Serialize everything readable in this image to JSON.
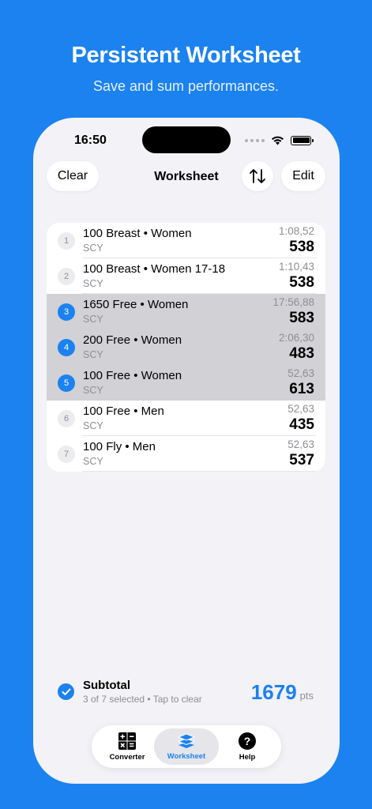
{
  "promo": {
    "headline": "Persistent Worksheet",
    "subhead": "Save and sum performances."
  },
  "status_bar": {
    "time": "16:50"
  },
  "nav": {
    "clear_label": "Clear",
    "title": "Worksheet",
    "edit_label": "Edit",
    "sort_icon": "sort-arrows-icon"
  },
  "rows": [
    {
      "num": "1",
      "event": "100 Breast • Women",
      "course": "SCY",
      "time": "1:08,52",
      "points": "538",
      "selected": false
    },
    {
      "num": "2",
      "event": "100 Breast • Women 17-18",
      "course": "SCY",
      "time": "1:10,43",
      "points": "538",
      "selected": false
    },
    {
      "num": "3",
      "event": "1650 Free • Women",
      "course": "SCY",
      "time": "17:56,88",
      "points": "583",
      "selected": true
    },
    {
      "num": "4",
      "event": "200 Free • Women",
      "course": "SCY",
      "time": "2:06,30",
      "points": "483",
      "selected": true
    },
    {
      "num": "5",
      "event": "100 Free • Women",
      "course": "SCY",
      "time": "52,63",
      "points": "613",
      "selected": true
    },
    {
      "num": "6",
      "event": "100 Free • Men",
      "course": "SCY",
      "time": "52,63",
      "points": "435",
      "selected": false
    },
    {
      "num": "7",
      "event": "100 Fly • Men",
      "course": "SCY",
      "time": "52,63",
      "points": "537",
      "selected": false
    }
  ],
  "subtotal": {
    "title": "Subtotal",
    "detail": "3 of 7 selected • Tap to clear",
    "points": "1679",
    "unit": "pts"
  },
  "tabs": [
    {
      "label": "Converter",
      "icon": "calculator-icon",
      "active": false
    },
    {
      "label": "Worksheet",
      "icon": "stack-icon",
      "active": true
    },
    {
      "label": "Help",
      "icon": "question-icon",
      "active": false
    }
  ],
  "colors": {
    "background": "#1b82f0",
    "accent": "#1b82f0",
    "selected_row": "#d1d1d6"
  }
}
